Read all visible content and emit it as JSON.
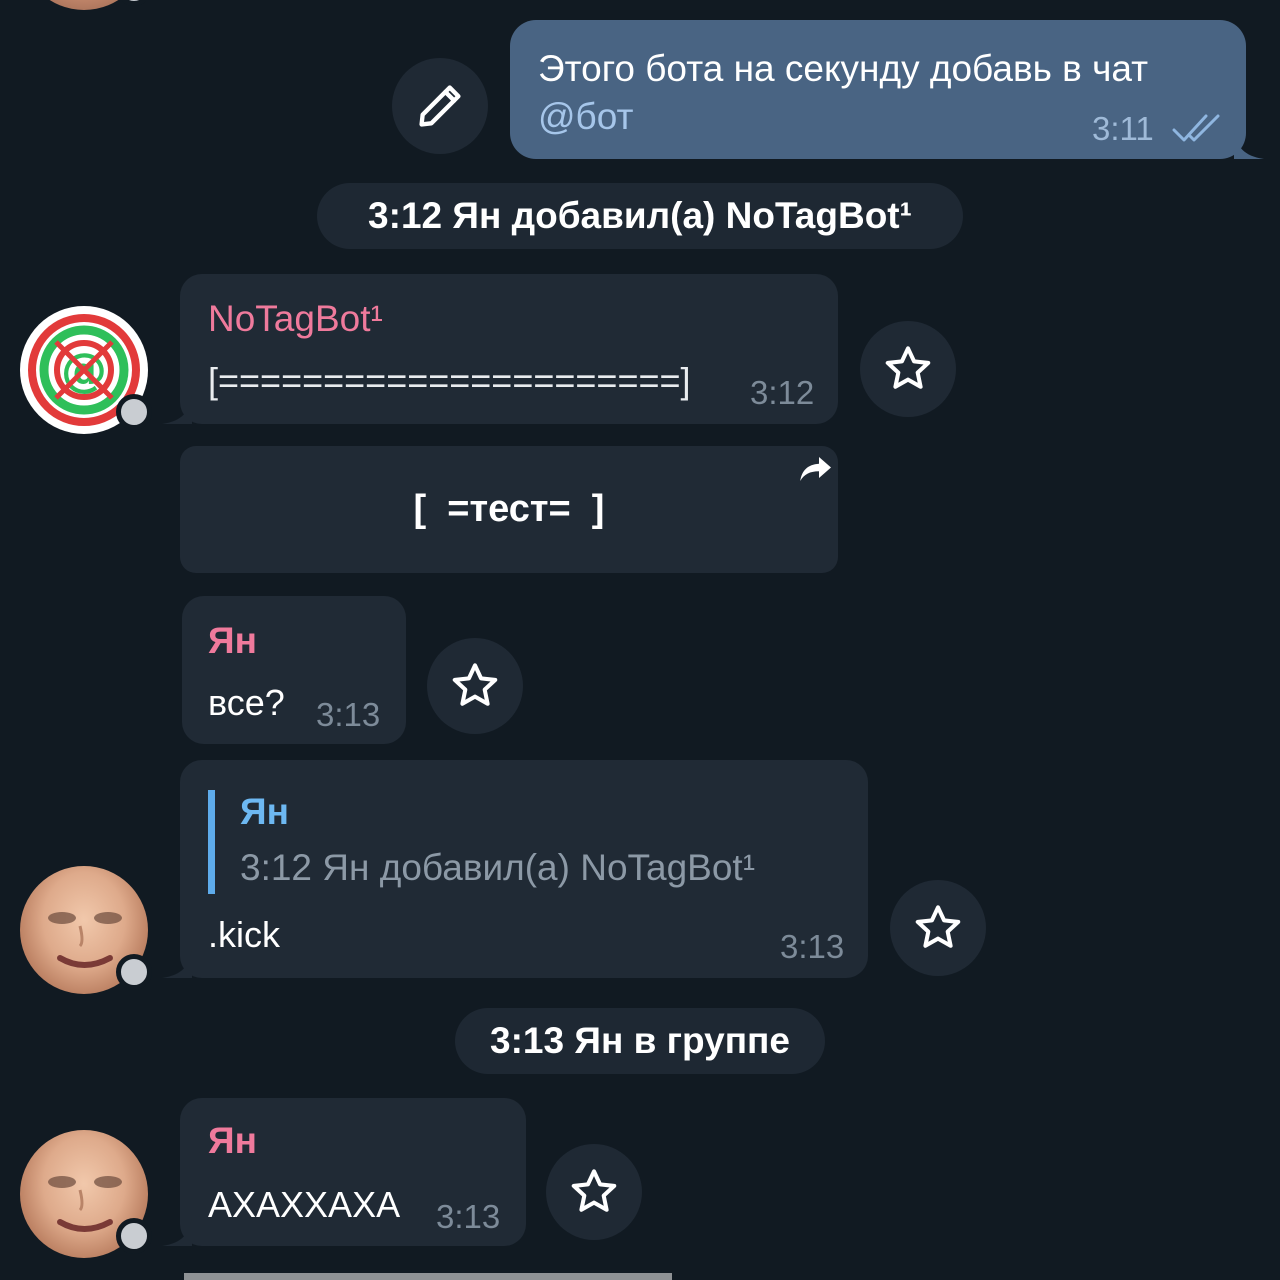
{
  "messages": {
    "outgoing_1": {
      "text": "Этого бота на секунду добавь в чат",
      "mention": "@бот",
      "time": "3:11",
      "read_icon": "double-check-icon"
    },
    "service_1": {
      "text": "3:12 Ян добавил(а) NoTagBot¹"
    },
    "bot_msg": {
      "sender": "NoTagBot¹",
      "text": "[======================]",
      "time": "3:12",
      "inline_button": "[  =тест=  ]",
      "share_icon": "share-arrow-icon"
    },
    "yan_1": {
      "sender": "Ян",
      "text": "все?",
      "time": "3:13"
    },
    "yan_2": {
      "reply_name": "Ян",
      "reply_text": "3:12 Ян добавил(а) NoTagBot¹",
      "text": ".kick",
      "time": "3:13"
    },
    "service_2": {
      "text": "3:13 Ян в группе"
    },
    "yan_3": {
      "sender": "Ян",
      "text": "АХАХХАХА",
      "time": "3:13"
    }
  },
  "colors": {
    "background": "#111a22",
    "incoming_bubble": "#202a35",
    "outgoing_bubble": "#496483",
    "sender_name": "#ef7a9c",
    "reply_accent": "#5eabeb",
    "time_incoming": "#7d8b99"
  }
}
